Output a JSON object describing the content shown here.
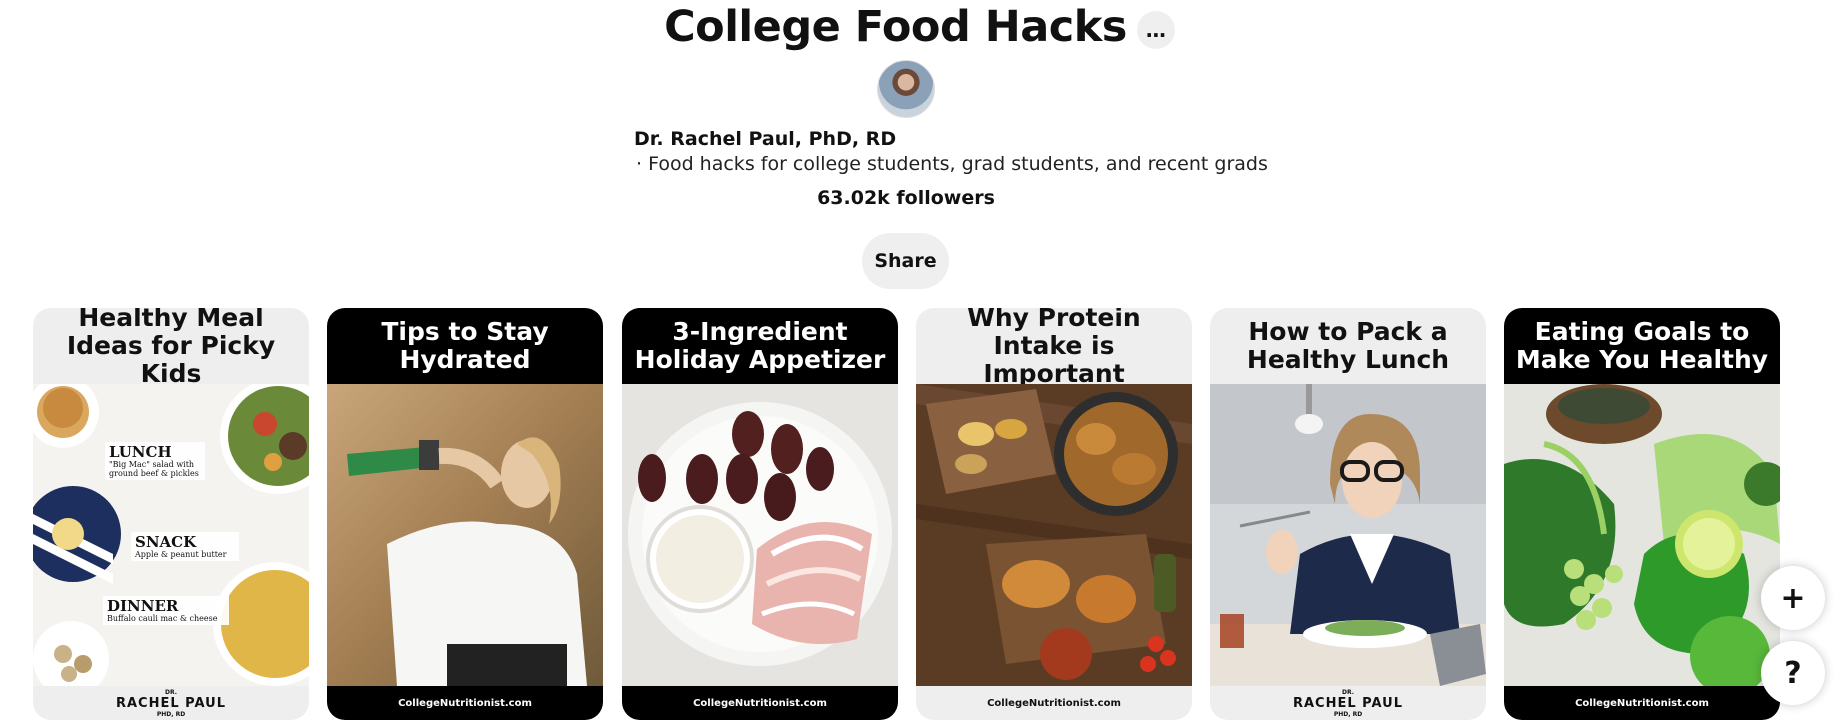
{
  "board": {
    "title": "College Food Hacks",
    "more_label": "…",
    "owner_name": "Dr. Rachel Paul, PhD, RD",
    "description": "· Food hacks for college students, grad students, and recent grads",
    "followers": "63.02k followers",
    "share_label": "Share"
  },
  "pins": [
    {
      "title": "Healthy Meal Ideas for Picky Kids",
      "footer_small": "DR.",
      "footer": "RACHEL PAUL",
      "footer_small2": "PHD, RD",
      "labels": [
        {
          "big": "LUNCH",
          "small": "\"Big Mac\" salad with ground beef & pickles"
        },
        {
          "big": "SNACK",
          "small": "Apple & peanut butter"
        },
        {
          "big": "DINNER",
          "small": "Buffalo cauli mac & cheese"
        }
      ]
    },
    {
      "title": "Tips to Stay Hydrated",
      "footer": "CollegeNutritionist.com"
    },
    {
      "title": "3-Ingredient Holiday Appetizer",
      "footer": "CollegeNutritionist.com"
    },
    {
      "title": "Why Protein Intake is Important",
      "footer": "CollegeNutritionist.com"
    },
    {
      "title": "How to Pack a Healthy Lunch",
      "footer_small": "DR.",
      "footer": "RACHEL PAUL",
      "footer_small2": "PHD, RD"
    },
    {
      "title": "Eating Goals to Make You Healthy",
      "footer": "CollegeNutritionist.com"
    }
  ],
  "floating": {
    "plus_label": "+",
    "help_label": "?"
  },
  "colors": {
    "button_bg": "#efefef",
    "pin_dark": "#000000",
    "pin_light": "#eeeeee"
  }
}
